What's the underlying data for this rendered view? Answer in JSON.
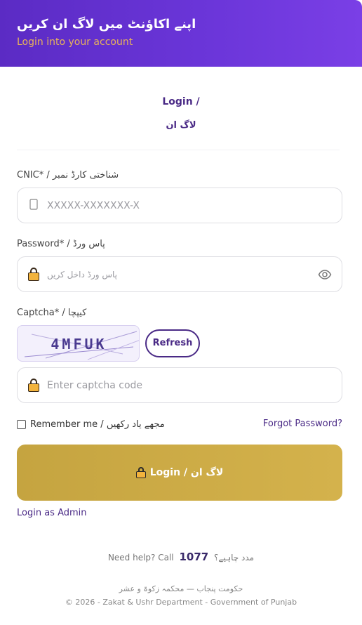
{
  "header": {
    "title_ur": "اپنے اکاؤنٹ میں لاگ ان کریں",
    "subtitle": "Login into your account"
  },
  "heading": {
    "en": "Login /",
    "ur": "لاگ ان"
  },
  "cnic": {
    "label": "CNIC* / شناختی کارڈ نمبر",
    "placeholder": "XXXXX-XXXXXXX-X",
    "icon": "id-card-icon"
  },
  "password": {
    "label": "Password* / پاس ورڈ",
    "placeholder": "پاس ورڈ داخل کریں",
    "icon": "lock-icon",
    "toggle_icon": "eye-icon"
  },
  "captcha": {
    "label": "Captcha* / کیپچا",
    "code": "4MFUK",
    "refresh_label": "Refresh",
    "placeholder": "Enter captcha code",
    "icon": "lock-icon"
  },
  "remember": {
    "label": "Remember me / مجھے یاد رکھیں"
  },
  "forgot_label": "Forgot Password?",
  "login_button": {
    "label": "Login / لاگ ان",
    "icon": "lock-icon"
  },
  "admin_link": "Login as Admin",
  "help": {
    "prefix": "Need help? Call",
    "number": "1077",
    "suffix_ur": "مدد چاہیے؟"
  },
  "footer": {
    "line1_ur": "حکومت پنجاب — محکمہ زکوۃ و عشر",
    "line2": "© 2026 - Zakat & Ushr Department - Government of Punjab"
  },
  "colors": {
    "header_gradient_start": "#5b2bc4",
    "header_gradient_end": "#7a3fe6",
    "accent": "#4a2a86",
    "subtitle_gold": "#e8b35a",
    "button_gold": "#c5a440"
  }
}
